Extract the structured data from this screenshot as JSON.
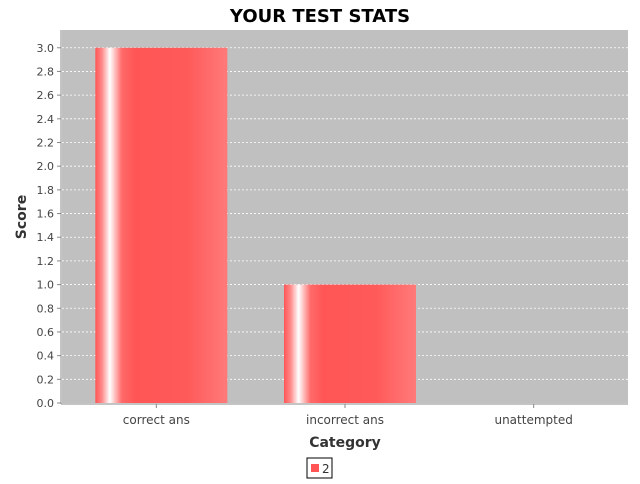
{
  "chart_data": {
    "type": "bar",
    "title": "YOUR TEST STATS",
    "xlabel": "Category",
    "ylabel": "Score",
    "categories": [
      "correct ans",
      "incorrect ans",
      "unattempted"
    ],
    "series": [
      {
        "name": "2",
        "values": [
          3.0,
          1.0,
          0.0
        ],
        "color": "#ff5555"
      }
    ],
    "ylim": [
      0,
      3.15
    ],
    "yticks": [
      "0.0",
      "0.2",
      "0.4",
      "0.6",
      "0.8",
      "1.0",
      "1.2",
      "1.4",
      "1.6",
      "1.8",
      "2.0",
      "2.2",
      "2.4",
      "2.6",
      "2.8",
      "3.0"
    ],
    "grid": true,
    "legend_position": "bottom",
    "plot_background": "#c0c0c0"
  }
}
